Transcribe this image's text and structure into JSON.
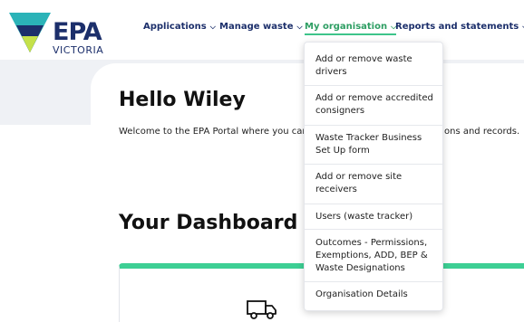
{
  "logo": {
    "name": "EPA",
    "subtitle": "VICTORIA"
  },
  "nav": [
    {
      "label": "Applications",
      "active": false
    },
    {
      "label": "Manage waste",
      "active": false
    },
    {
      "label": "My organisation",
      "active": true
    },
    {
      "label": "Reports and statements",
      "active": false
    }
  ],
  "hello": {
    "title": "Hello Wiley",
    "welcome_visible_left": "Welcome to the EPA Portal where you can",
    "welcome_visible_right": "ons and records."
  },
  "dashboard": {
    "title": "Your Dashboard",
    "card_icon": "truck-icon"
  },
  "dropdown": {
    "items": [
      {
        "label": "Add or remove waste drivers"
      },
      {
        "label": "Add or remove accredited consigners"
      },
      {
        "label": "Waste Tracker Business Set Up form"
      },
      {
        "label": "Add or remove site receivers"
      },
      {
        "label": "Users (waste tracker)"
      },
      {
        "label": "Outcomes - Permissions, Exemptions, ADD, BEP & Waste Designations"
      },
      {
        "label": "Organisation Details"
      }
    ]
  },
  "colors": {
    "brand_navy": "#1c2f6b",
    "accent_green": "#3dc48a",
    "logo_teal": "#2bb3b8",
    "logo_lime": "#c5e14a"
  }
}
